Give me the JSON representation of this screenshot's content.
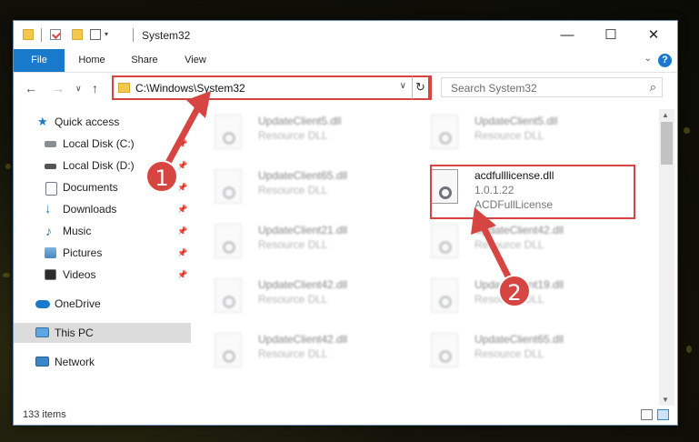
{
  "window": {
    "title": "System32",
    "minimize": "—",
    "maximize": "☐",
    "close": "✕"
  },
  "ribbon": {
    "tabs": [
      "File",
      "Home",
      "Share",
      "View"
    ],
    "help": "?"
  },
  "address": {
    "path": "C:\\Windows\\System32",
    "search_placeholder": "Search System32"
  },
  "sidebar": {
    "items": [
      {
        "label": "Quick access",
        "icon": "star-icon"
      },
      {
        "label": "Local Disk (C:)",
        "icon": "drive-icon"
      },
      {
        "label": "Local Disk (D:)",
        "icon": "drive-icon"
      },
      {
        "label": "Documents",
        "icon": "documents-icon"
      },
      {
        "label": "Downloads",
        "icon": "download-arrow-icon"
      },
      {
        "label": "Music",
        "icon": "music-note-icon"
      },
      {
        "label": "Pictures",
        "icon": "pictures-icon"
      },
      {
        "label": "Videos",
        "icon": "videos-icon"
      },
      {
        "label": "OneDrive",
        "icon": "cloud-icon"
      },
      {
        "label": "This PC",
        "icon": "computer-icon"
      },
      {
        "label": "Network",
        "icon": "network-icon"
      }
    ]
  },
  "files": [
    {
      "name": "UpdateClient5.dll",
      "type": "Resource DLL"
    },
    {
      "name": "UpdateClient5.dll",
      "type": "Resource DLL"
    },
    {
      "name": "UpdateClient65.dll",
      "type": "Resource DLL"
    },
    {
      "name": "acdfulllicense.dll",
      "version": "1.0.1.22",
      "description": "ACDFullLicense"
    },
    {
      "name": "UpdateClient21.dll",
      "type": "Resource DLL"
    },
    {
      "name": "UpdateClient42.dll",
      "type": "Resource DLL"
    },
    {
      "name": "UpdateClient42.dll",
      "type": "Resource DLL"
    },
    {
      "name": "UpdateClient19.dll",
      "type": "Resource DLL"
    },
    {
      "name": "UpdateClient42.dll",
      "type": "Resource DLL"
    },
    {
      "name": "UpdateClient65.dll",
      "type": "Resource DLL"
    }
  ],
  "status": {
    "item_count": "133 items"
  },
  "annotations": {
    "step1": "1",
    "step2": "2",
    "color": "#d64541"
  }
}
